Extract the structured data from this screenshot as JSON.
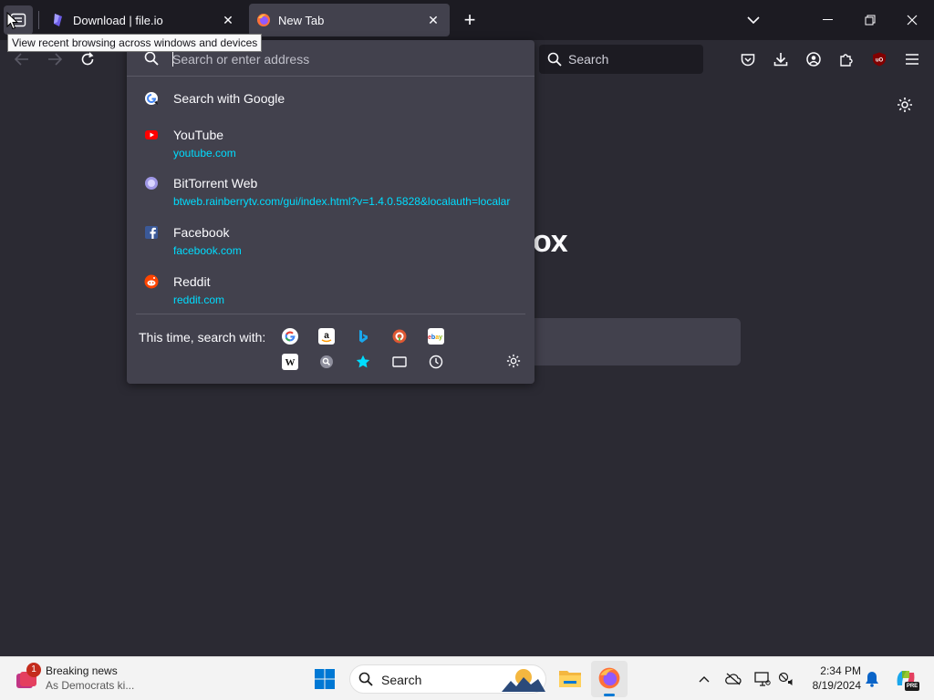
{
  "tabs": [
    {
      "title": "Download | file.io",
      "close": "✕"
    },
    {
      "title": "New Tab",
      "close": "✕"
    }
  ],
  "new_tab_symbol": "+",
  "tooltip": "View recent browsing across windows and devices",
  "navbar": {
    "search_placeholder": "Search"
  },
  "urlbar": {
    "placeholder": "Search or enter address",
    "results": [
      {
        "title": "Search with Google",
        "url": "",
        "icon": "google-icon"
      },
      {
        "title": "YouTube",
        "url": "youtube.com",
        "icon": "youtube-icon"
      },
      {
        "title": "BitTorrent Web",
        "url": "btweb.rainberrytv.com/gui/index.html?v=1.4.0.5828&localauth=localar",
        "icon": "bittorrent-icon"
      },
      {
        "title": "Facebook",
        "url": "facebook.com",
        "icon": "facebook-icon"
      },
      {
        "title": "Reddit",
        "url": "reddit.com",
        "icon": "reddit-icon"
      }
    ],
    "oneoff_label": "This time, search with:",
    "engines": [
      "google",
      "amazon",
      "bing",
      "duckduckgo",
      "ebay",
      "wikipedia",
      "search",
      "bookmarks",
      "tabs",
      "history"
    ]
  },
  "content": {
    "brand_fragment": "ox"
  },
  "taskbar": {
    "news_title": "Breaking news",
    "news_sub": "As Democrats ki...",
    "news_badge": "1",
    "search_placeholder": "Search",
    "time": "2:34 PM",
    "date": "8/19/2024",
    "copilot_badge": "PRE"
  },
  "colors": {
    "url_link": "#00ddff",
    "popup_bg": "#42414d",
    "toolbar_bg": "#2b2a33",
    "tab_strip_bg": "#1c1b22"
  }
}
